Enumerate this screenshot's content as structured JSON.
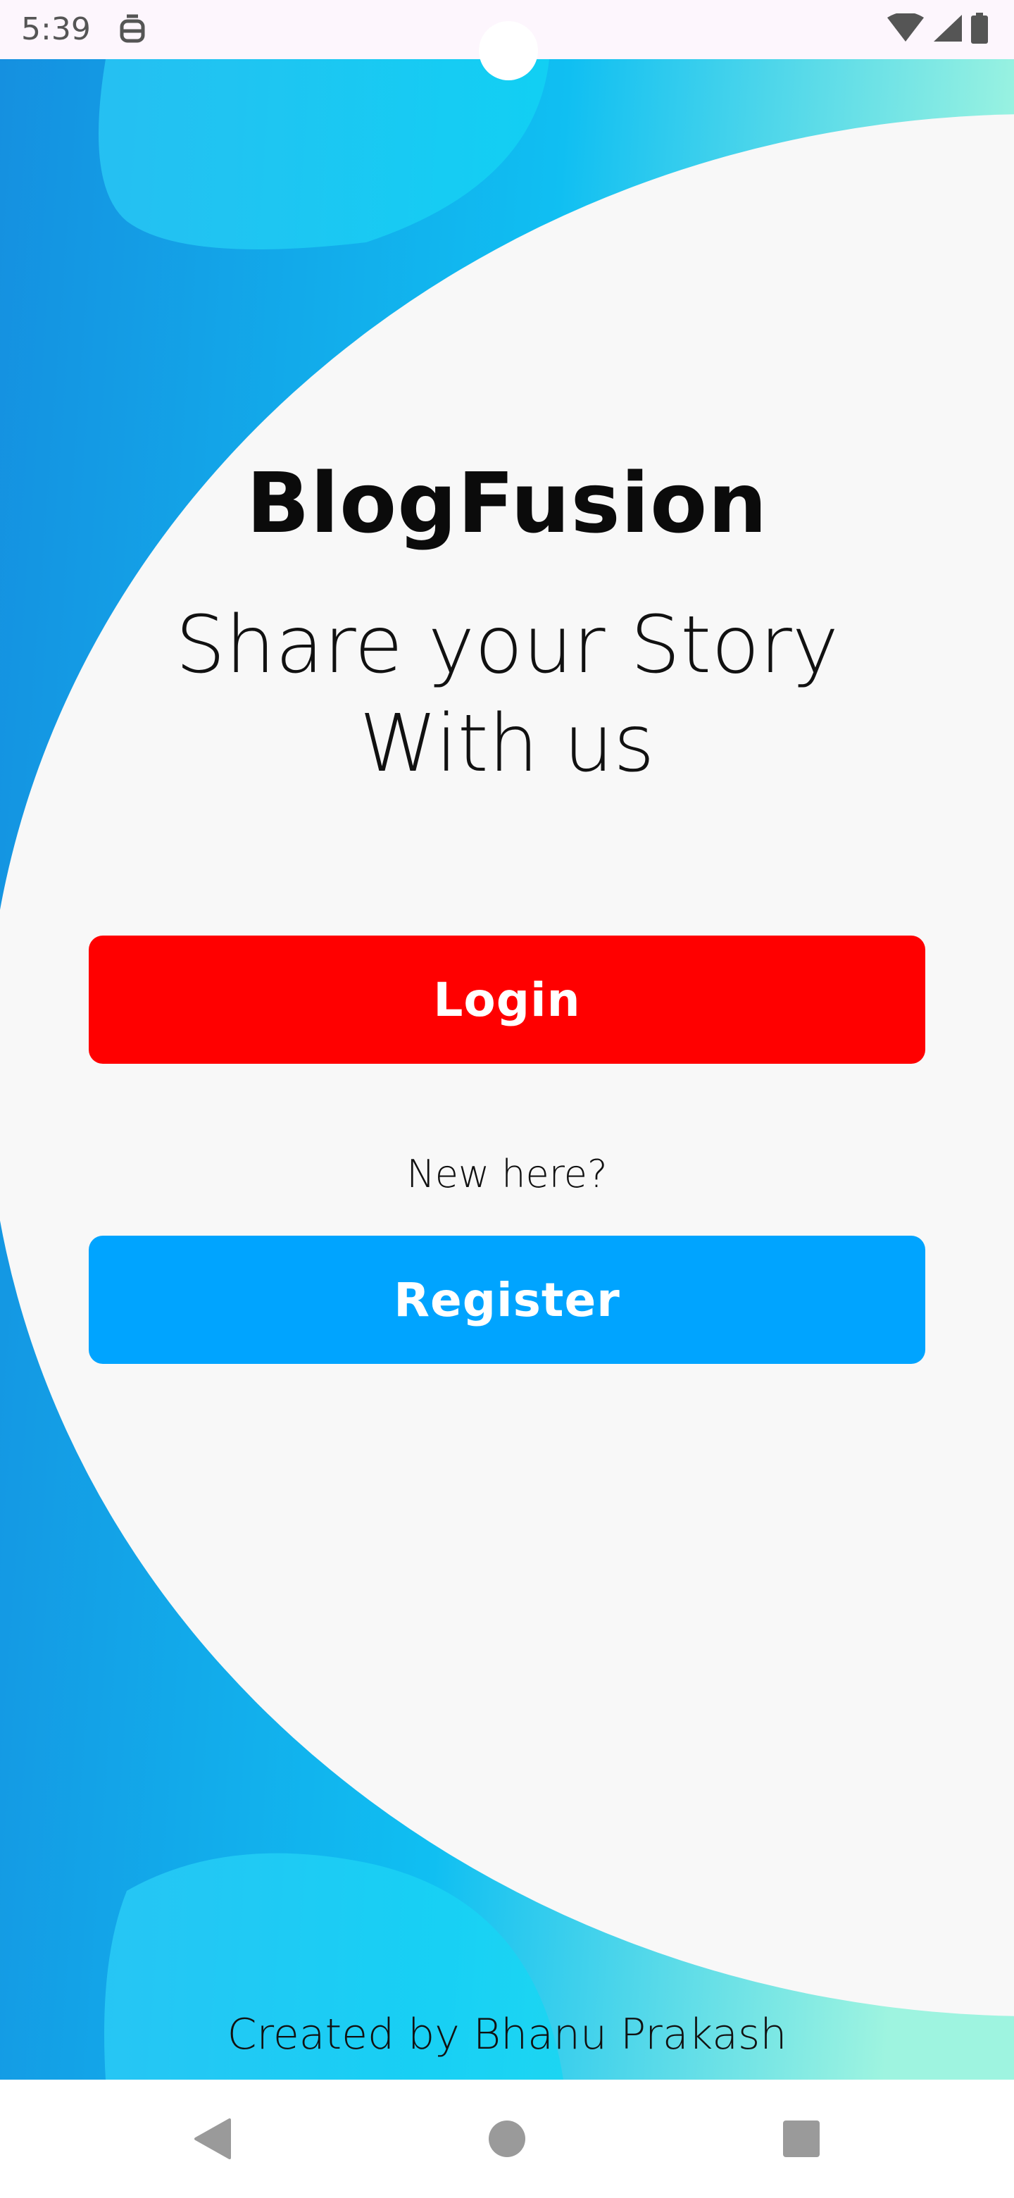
{
  "status_bar": {
    "time": "5:39",
    "notification_icon": "robot-face-icon",
    "right_icons": [
      "wifi-icon",
      "cell-signal-icon",
      "battery-icon"
    ]
  },
  "app": {
    "title": "BlogFusion",
    "tagline_line1": "Share your Story",
    "tagline_line2": "With us"
  },
  "actions": {
    "login_label": "Login",
    "prompt": "New here?",
    "register_label": "Register"
  },
  "footer": {
    "credit": "Created by Bhanu Prakash"
  },
  "nav_bar": {
    "icons": [
      "back-icon",
      "home-icon",
      "recents-icon"
    ]
  },
  "colors": {
    "login_button": "#ff0000",
    "register_button": "#00a4ff",
    "background_panel": "#f8f8f8",
    "accent_blue": "#1190e0",
    "accent_cyan": "#12d3f5"
  }
}
